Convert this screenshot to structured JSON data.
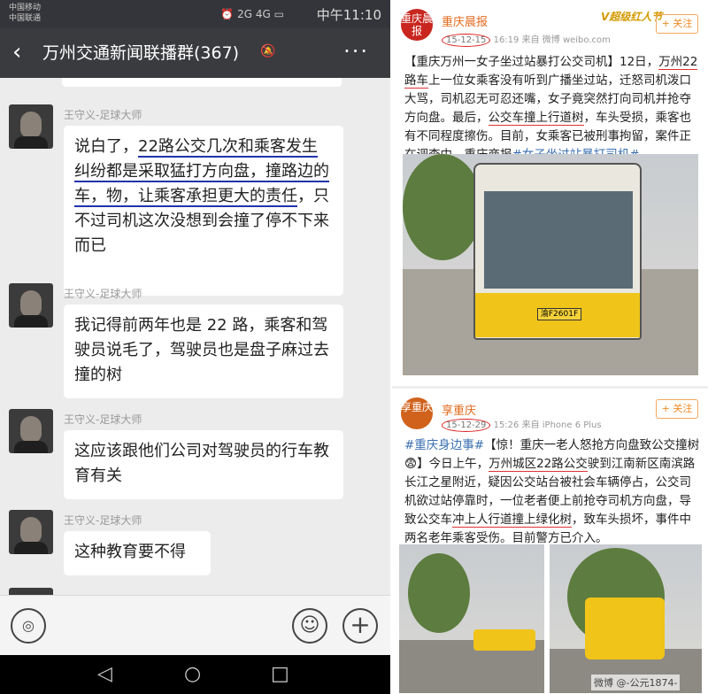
{
  "status_bar": {
    "carrier1": "中国移动",
    "carrier2": "中国联通",
    "time": "中午11:10",
    "icons": "⏰ 2G 4G ▭"
  },
  "chat_header": {
    "back": "‹",
    "title": "万州交通新闻联播群(367)",
    "mute_icon": "bell-muted-icon",
    "more": "···"
  },
  "messages": [
    {
      "sender": "王守义-足球大师",
      "segments": [
        {
          "text": "说白了，",
          "ul": ""
        },
        {
          "text": "22路公交几次和乘客发生纠纷都是采取猛打方向盘，撞路边的车，物，让乘客承担更大的责任",
          "ul": "ul"
        },
        {
          "text": "，只不过司机这次没想到会撞了停不下来而已",
          "ul": ""
        }
      ]
    },
    {
      "sender": "王守义-足球大师",
      "text": "我记得前两年也是 22 路，乘客和驾驶员说毛了，驾驶员也是盘子麻过去撞的树"
    },
    {
      "sender": "王守义-足球大师",
      "text": "这应该跟他们公司对驾驶员的行车教育有关"
    },
    {
      "sender": "王守义-足球大师",
      "text": "这种教育要不得"
    },
    {
      "sender": "王守义-足球大师",
      "text": ""
    }
  ],
  "input_bar": {
    "voice_icon": "voice-icon",
    "emoji_icon": "emoji-icon",
    "plus_icon": "plus-icon",
    "voice": "◎",
    "emoji": "☺",
    "plus": "+"
  },
  "nav_bar": {
    "back": "◁",
    "home": "○",
    "recent": "□"
  },
  "posts": [
    {
      "logo": "重庆晨报",
      "account": "重庆晨报",
      "date": "15-12-15",
      "time": "16:19",
      "source": "来自 微博 weibo.com",
      "follow": "+ 关注",
      "badge": "V超级红人节",
      "segments": [
        {
          "text": "【重庆万州一女子坐过站暴打公交司机】12日，",
          "c": ""
        },
        {
          "text": "万州22路车",
          "c": "ul"
        },
        {
          "text": "上一位女乘客没有听到广播坐过站，迁怒司机泼口大骂，司机忍无可忍还嘴，女子竟突然打向司机并抢夺方向盘。最后，",
          "c": ""
        },
        {
          "text": "公交车撞上行道树",
          "c": "ul"
        },
        {
          "text": "，车头受损，乘客也有不同程度擦伤。目前，女乘客已被刑事拘留，案件正在调查中。重庆商报",
          "c": ""
        },
        {
          "text": "#女子坐过站暴打司机#",
          "c": "tag"
        }
      ],
      "plate": "渝F2601F"
    },
    {
      "logo": "享重庆",
      "account": "享重庆",
      "date": "15-12-29",
      "time": "15:26",
      "source": "来自 iPhone 6 Plus",
      "follow": "+ 关注",
      "segments": [
        {
          "text": "#重庆身边事#",
          "c": "tag"
        },
        {
          "text": "【惊！重庆一老人怒抢方向盘致公交撞树😨】今日上午，",
          "c": ""
        },
        {
          "text": "万州城区22路公交",
          "c": "ul"
        },
        {
          "text": "驶到江南新区南滨路长江之星附近，疑因公交站台被社会车辆停占，公交司机欲过站停靠时，一位老者便上前抢夺司机方向盘，导致公交车",
          "c": ""
        },
        {
          "text": "冲上人行道撞上绿化树",
          "c": "ul"
        },
        {
          "text": "，致车头损坏，事件中两名老年乘客受伤。目前警方已介入。",
          "c": ""
        }
      ]
    }
  ],
  "watermark": "微博 @-公元1874-",
  "colors": {
    "header_bg": "#3a3b3f",
    "chat_bg": "#ececec",
    "accent_orange": "#e26a1c",
    "underline_red": "#d33"
  }
}
